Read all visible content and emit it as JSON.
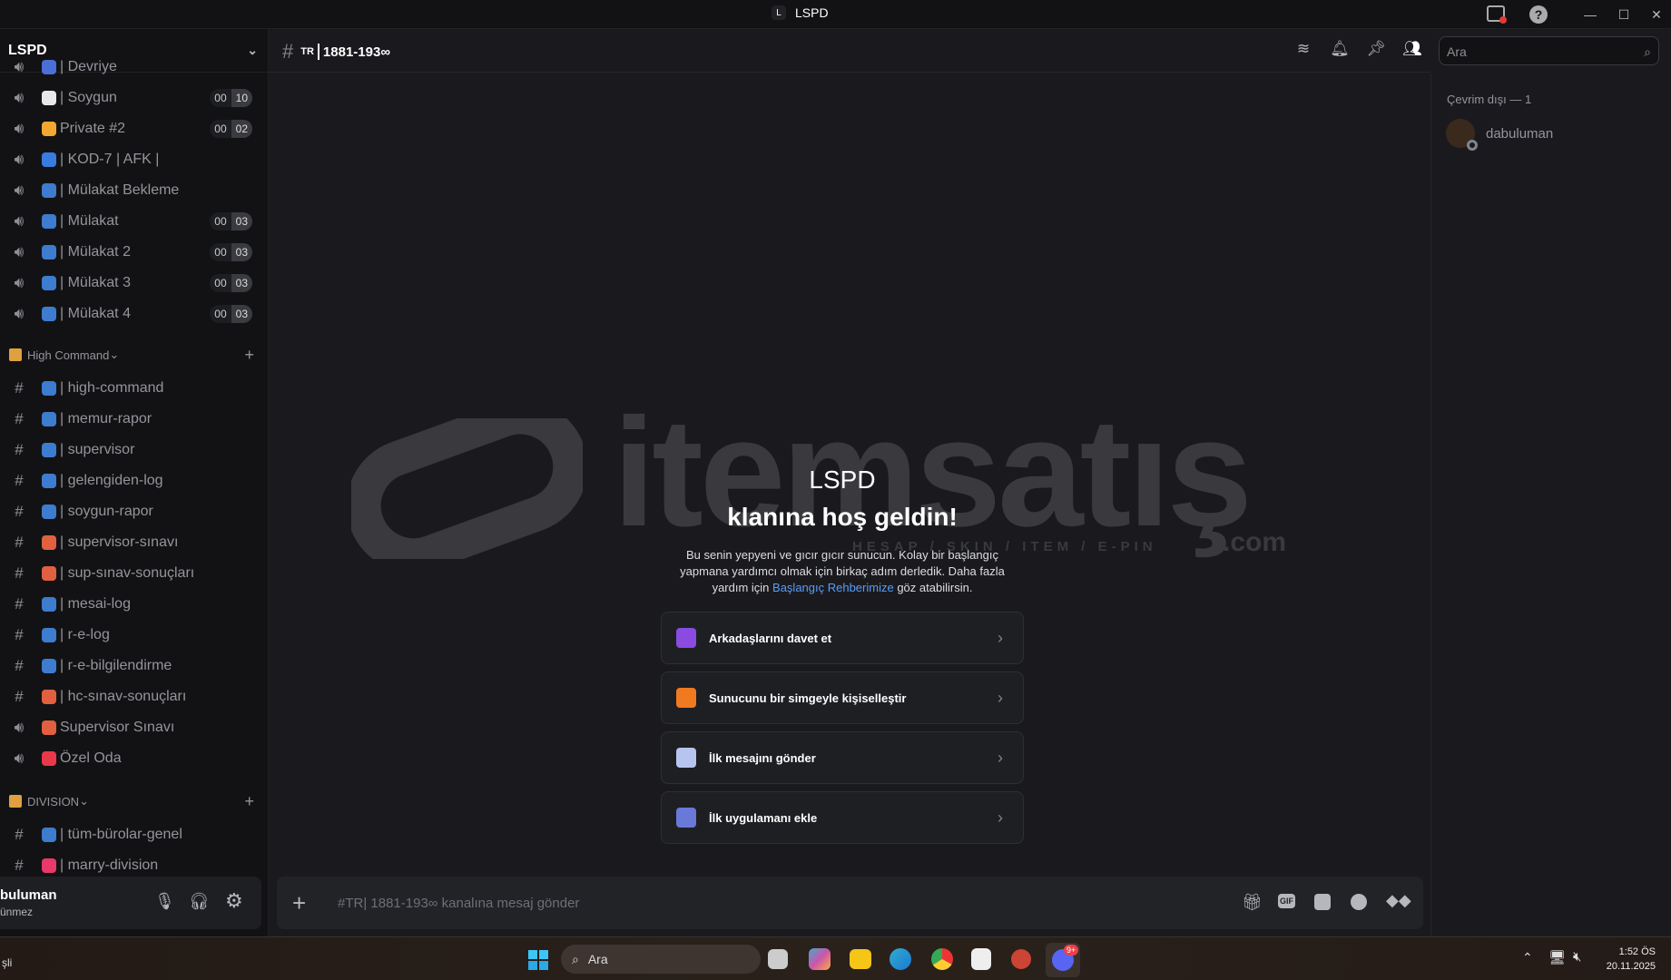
{
  "window": {
    "title": "LSPD",
    "badge": "L"
  },
  "server": {
    "name": "LSPD"
  },
  "voice_channels": [
    {
      "name": "| Devriye",
      "emoji_color": "#4a6fd6"
    },
    {
      "name": "| Soygun",
      "emoji_color": "#e8e8e8",
      "count_a": "00",
      "count_b": "10"
    },
    {
      "name": "Private #2",
      "emoji_color": "#f0a830",
      "count_a": "00",
      "count_b": "02"
    },
    {
      "name": "| KOD-7 | AFK |",
      "emoji_color": "#3a7be0"
    },
    {
      "name": "| Mülakat Bekleme",
      "emoji_color": "#3d7ccf"
    },
    {
      "name": "| Mülakat",
      "emoji_color": "#3d7ccf",
      "count_a": "00",
      "count_b": "03"
    },
    {
      "name": "| Mülakat 2",
      "emoji_color": "#3d7ccf",
      "count_a": "00",
      "count_b": "03"
    },
    {
      "name": "| Mülakat 3",
      "emoji_color": "#3d7ccf",
      "count_a": "00",
      "count_b": "03"
    },
    {
      "name": "| Mülakat 4",
      "emoji_color": "#3d7ccf",
      "count_a": "00",
      "count_b": "03"
    }
  ],
  "categories": [
    {
      "name": "High Command",
      "channels": [
        {
          "type": "text",
          "name": "| high-command",
          "emoji_color": "#3d7ccf"
        },
        {
          "type": "text",
          "name": "| memur-rapor",
          "emoji_color": "#3d7ccf"
        },
        {
          "type": "text",
          "name": "| supervisor",
          "emoji_color": "#3d7ccf"
        },
        {
          "type": "text",
          "name": "| gelengiden-log",
          "emoji_color": "#3d7ccf"
        },
        {
          "type": "text",
          "name": "| soygun-rapor",
          "emoji_color": "#3d7ccf"
        },
        {
          "type": "text",
          "name": "| supervisor-sınavı",
          "emoji_color": "#e06040"
        },
        {
          "type": "text",
          "name": "| sup-sınav-sonuçları",
          "emoji_color": "#e06040"
        },
        {
          "type": "text",
          "name": "| mesai-log",
          "emoji_color": "#3d7ccf"
        },
        {
          "type": "text",
          "name": "| r-e-log",
          "emoji_color": "#3d7ccf"
        },
        {
          "type": "text",
          "name": "| r-e-bilgilendirme",
          "emoji_color": "#3d7ccf"
        },
        {
          "type": "text",
          "name": "| hc-sınav-sonuçları",
          "emoji_color": "#e06040"
        },
        {
          "type": "voice",
          "name": "Supervisor Sınavı",
          "emoji_color": "#e06040"
        },
        {
          "type": "voice",
          "name": "Özel Oda",
          "emoji_color": "#e8394a"
        }
      ]
    },
    {
      "name": "DIVISION",
      "channels": [
        {
          "type": "text",
          "name": "| tüm-bürolar-genel",
          "emoji_color": "#3d7ccf"
        },
        {
          "type": "text",
          "name": "| marry-division",
          "emoji_color": "#e8396a"
        }
      ]
    }
  ],
  "header": {
    "channel_prefix": "TR",
    "channel_name": "1881-193∞",
    "search_placeholder": "Ara"
  },
  "members": {
    "section": "Çevrim dışı — 1",
    "items": [
      {
        "name": "dabuluman"
      }
    ]
  },
  "welcome": {
    "title1": "LSPD",
    "title2": "klanına hoş geldin!",
    "text1": "Bu senin yepyeni ve gıcır gıcır sunucun. Kolay bir başlangıç",
    "text2": "yapmana yardımcı olmak için birkaç adım derledik. Daha fazla",
    "text3a": "yardım için ",
    "link": "Başlangıç Rehberimize",
    "text3b": " göz atabilirsin.",
    "cards": [
      {
        "label": "Arkadaşlarını davet et",
        "color": "#8a4be0"
      },
      {
        "label": "Sunucunu bir simgeyle kişiselleştir",
        "color": "#f07a20"
      },
      {
        "label": "İlk mesajını gönder",
        "color": "#b8c4f0"
      },
      {
        "label": "İlk uygulamanı ekle",
        "color": "#6a78d8"
      }
    ]
  },
  "watermark": {
    "brand": "itemsatış",
    "tagline": "HESAP / SKIN / ITEM / E-PIN",
    "tld": ".com"
  },
  "composer": {
    "placeholder": "#TR| 1881-193∞ kanalına mesaj gönder",
    "gif": "GIF"
  },
  "user": {
    "name": "buluman",
    "status": "ünmez"
  },
  "taskbar": {
    "left_text": "şli",
    "search": "Ara",
    "time": "1:52 ÖS",
    "date": "20.11.2025",
    "discord_badge": "9+"
  }
}
